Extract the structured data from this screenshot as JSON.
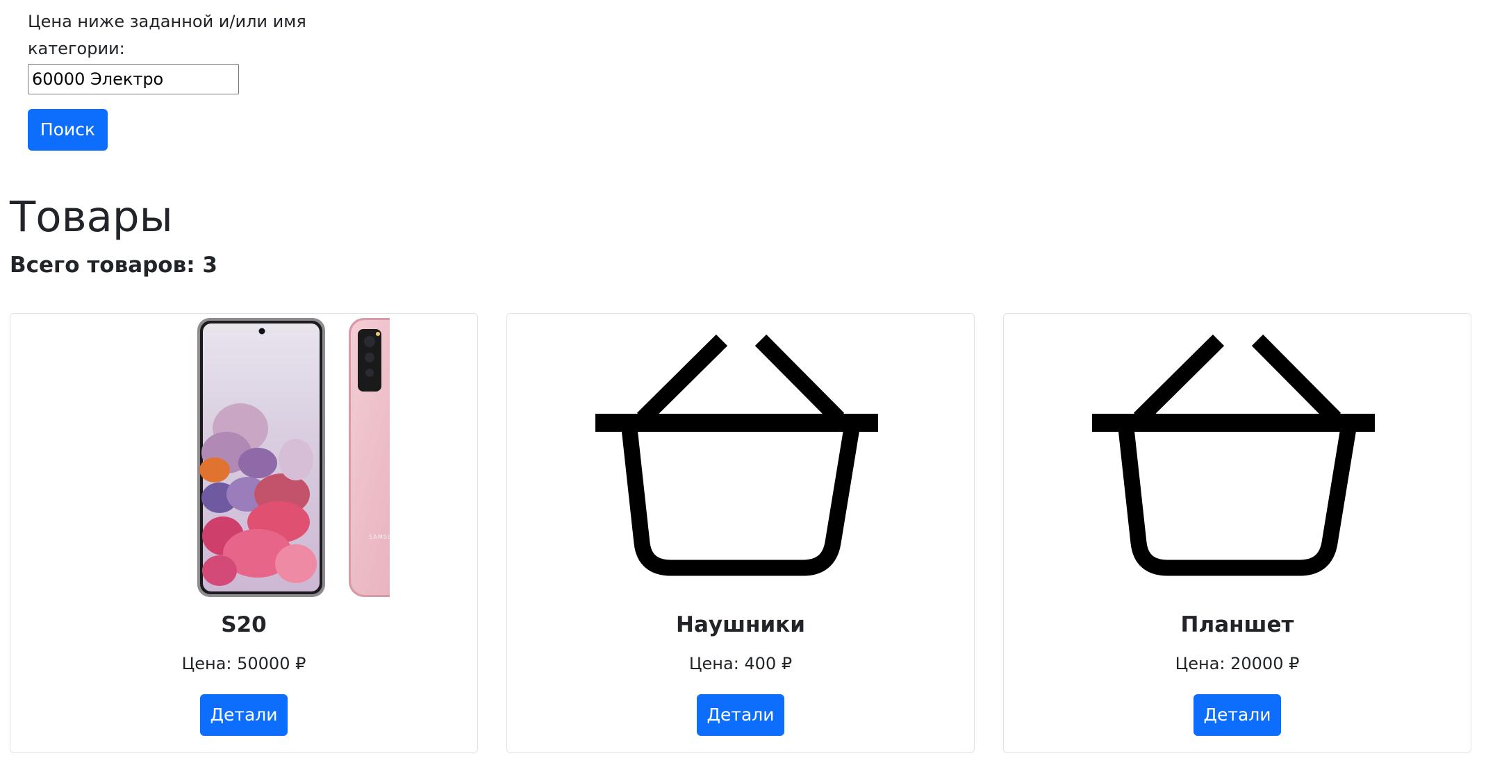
{
  "search": {
    "label": "Цена ниже заданной и/или имя категории:",
    "value": "60000 Электро",
    "button_label": "Поиск"
  },
  "products": {
    "title": "Товары",
    "total_text": "Всего товаров: 3",
    "items": [
      {
        "name": "S20",
        "price_text": "Цена: 50000 ₽",
        "details_label": "Детали",
        "image": "phone-image",
        "brand_text": "SAMSUNG"
      },
      {
        "name": "Наушники",
        "price_text": "Цена: 400 ₽",
        "details_label": "Детали",
        "image": "basket-icon"
      },
      {
        "name": "Планшет",
        "price_text": "Цена: 20000 ₽",
        "details_label": "Детали",
        "image": "basket-icon"
      }
    ]
  },
  "colors": {
    "primary": "#0d6efd",
    "text": "#212529",
    "card_border": "#dee2e6"
  }
}
